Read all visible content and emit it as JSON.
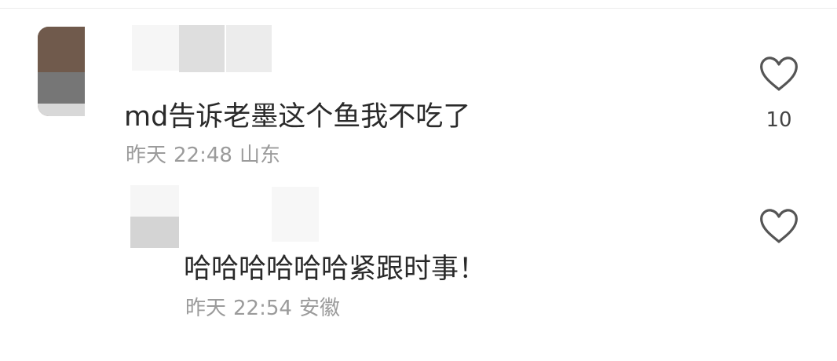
{
  "comments": [
    {
      "text": "md告诉老墨这个鱼我不吃了",
      "date": "昨天",
      "time": "22:48",
      "location": "山东",
      "likes": "10"
    },
    {
      "text": "哈哈哈哈哈哈紧跟时事！",
      "date": "昨天",
      "time": "22:54",
      "location": "安徽"
    }
  ],
  "icons": {
    "like": "heart-outline-icon"
  },
  "colors": {
    "text_primary": "#2a2a2a",
    "text_meta": "#9b9b9b",
    "icon": "#555555",
    "background": "#ffffff"
  }
}
